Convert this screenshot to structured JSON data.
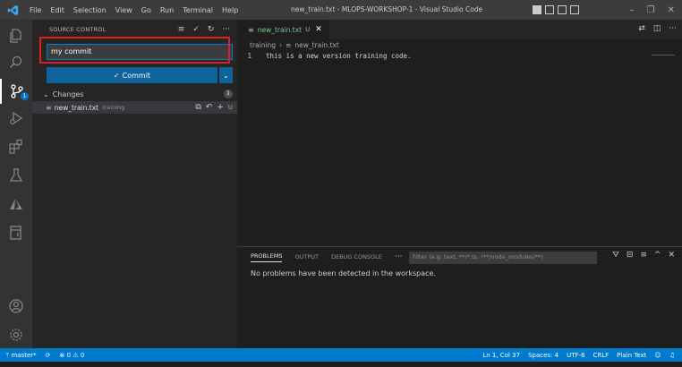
{
  "titlebar": {
    "menu": [
      "File",
      "Edit",
      "Selection",
      "View",
      "Go",
      "Run",
      "Terminal",
      "Help"
    ],
    "title": "new_train.txt - MLOPS-WORKSHOP-1 - Visual Studio Code"
  },
  "activity": {
    "icons": [
      "explorer-icon",
      "search-icon",
      "source-control-icon",
      "run-debug-icon",
      "extensions-icon",
      "testing-icon",
      "azure-icon",
      "remote-explorer-icon",
      "accounts-icon",
      "settings-gear-icon"
    ],
    "scm_badge": "1"
  },
  "sidebar": {
    "title": "SOURCE CONTROL",
    "commit_message": "my commit",
    "commit_button": "Commit",
    "changes_label": "Changes",
    "changes_count": "1",
    "file": {
      "name": "new_train.txt",
      "dir": "training",
      "status": "U"
    }
  },
  "editor": {
    "tab": {
      "label": "new_train.txt",
      "status": "U"
    },
    "breadcrumb": [
      "training",
      "new_train.txt"
    ],
    "lines": [
      {
        "number": "1",
        "text": "this is a new version training code."
      }
    ]
  },
  "panel": {
    "tabs": [
      "PROBLEMS",
      "OUTPUT",
      "DEBUG CONSOLE"
    ],
    "filter_placeholder": "Filter (e.g. text, **/*.ts, !**/node_modules/**)",
    "message": "No problems have been detected in the workspace."
  },
  "statusbar": {
    "branch": "master*",
    "errors": "0",
    "warnings": "0",
    "position": "Ln 1, Col 37",
    "spaces": "Spaces: 4",
    "encoding": "UTF-8",
    "eol": "CRLF",
    "language": "Plain Text"
  },
  "colors": {
    "accent": "#007acc",
    "button": "#0e639c",
    "highlight_box": "#e01c1c",
    "untracked": "#73c991"
  }
}
